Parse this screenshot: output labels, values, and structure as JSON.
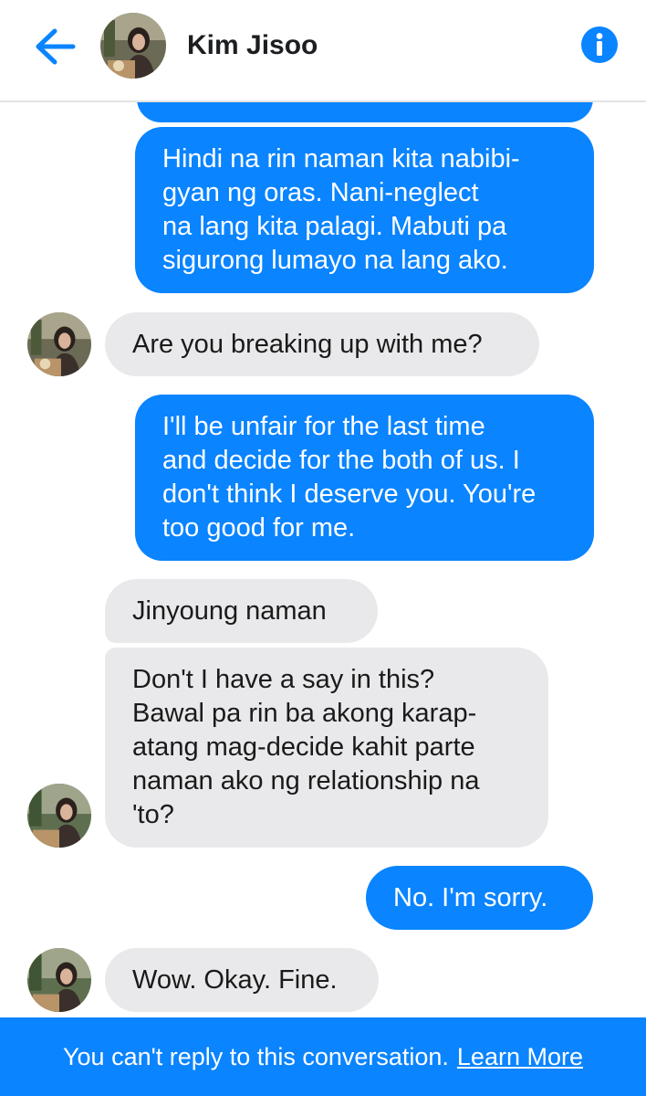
{
  "header": {
    "back_icon": "arrow-left-icon",
    "contact_name": "Kim Jisoo",
    "info_icon": "info-icon",
    "accent_color": "#0a84ff"
  },
  "messages": [
    {
      "direction": "outgoing",
      "text": "Hindi na rin naman kita nabibi-\ngyan ng oras. Nani-neglect\nna lang kita palagi. Mabuti pa\nsigurong lumayo na lang ako."
    },
    {
      "direction": "incoming",
      "text": "Are you breaking up with me?"
    },
    {
      "direction": "outgoing",
      "text": "I'll be unfair for the last time\nand decide for the both of us. I\ndon't think I deserve you. You're\ntoo good for me."
    },
    {
      "direction": "incoming",
      "text": "Jinyoung naman"
    },
    {
      "direction": "incoming",
      "text": "Don't I have a say in this?\nBawal pa rin ba akong karap-\natang mag-decide kahit parte\nnaman ako ng relationship na\n'to?"
    },
    {
      "direction": "outgoing",
      "text": "No. I'm sorry."
    },
    {
      "direction": "incoming",
      "text": "Wow. Okay. Fine."
    }
  ],
  "footer": {
    "notice": "You can't reply to this conversation.",
    "link": "Learn More"
  },
  "colors": {
    "outgoing_bubble": "#0a84ff",
    "incoming_bubble": "#e9e9eb",
    "footer_bg": "#0a84ff"
  }
}
